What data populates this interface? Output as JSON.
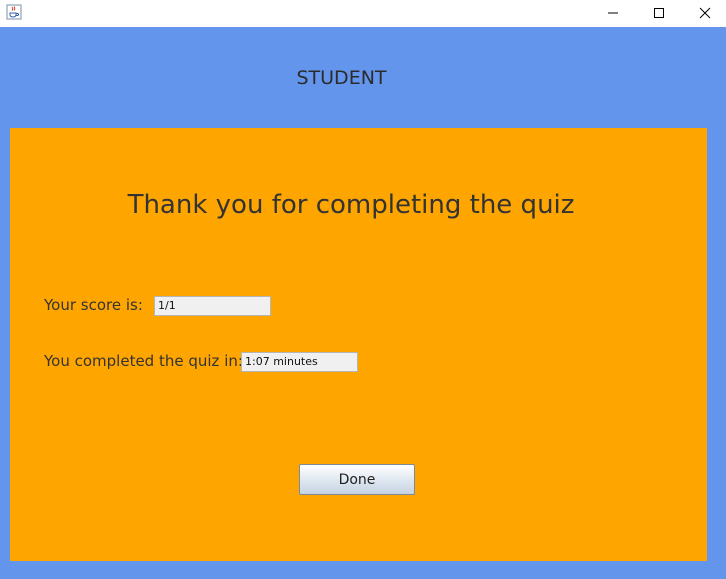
{
  "window": {
    "icons": {
      "app": "java-cup-icon",
      "minimize": "minimize-icon",
      "maximize": "maximize-icon",
      "close": "close-icon"
    }
  },
  "header": {
    "title": "STUDENT"
  },
  "panel": {
    "heading": "Thank you for completing the quiz",
    "score_label": "Your score is:",
    "score_value": "1/1",
    "time_label": "You completed the quiz in:",
    "time_value": "1:07 minutes",
    "done_label": "Done"
  },
  "colors": {
    "background": "#6495ed",
    "panel": "#ffa500"
  }
}
